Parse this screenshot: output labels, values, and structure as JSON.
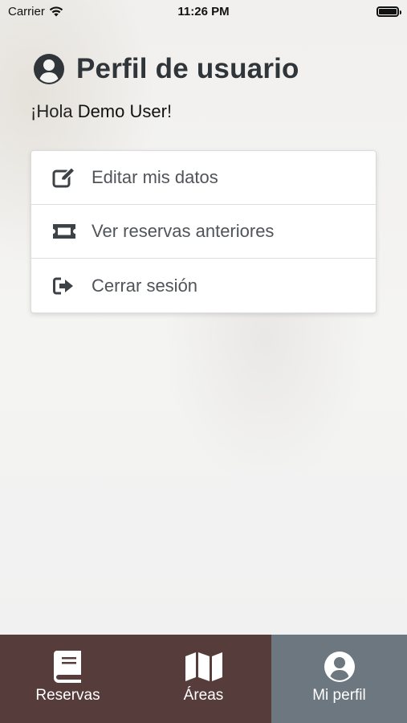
{
  "status_bar": {
    "carrier": "Carrier",
    "time": "11:26 PM",
    "battery_level": 1.0
  },
  "header": {
    "title": "Perfil de usuario",
    "icon": "user-circle-icon"
  },
  "greeting": {
    "prefix": "¡Hola ",
    "name": "Demo User",
    "suffix": "!"
  },
  "menu": {
    "items": [
      {
        "label": "Editar mis datos",
        "icon": "edit-icon"
      },
      {
        "label": "Ver reservas anteriores",
        "icon": "ticket-icon"
      },
      {
        "label": "Cerrar sesión",
        "icon": "sign-out-icon"
      }
    ]
  },
  "tabs": [
    {
      "label": "Reservas",
      "icon": "book-icon",
      "active": false
    },
    {
      "label": "Áreas",
      "icon": "map-icon",
      "active": false
    },
    {
      "label": "Mi perfil",
      "icon": "user-circle-icon",
      "active": true
    }
  ],
  "colors": {
    "tab_background": "#563c3a",
    "tab_active_background": "#6c7780",
    "title_color": "#2f3539",
    "menu_text": "#505458"
  }
}
